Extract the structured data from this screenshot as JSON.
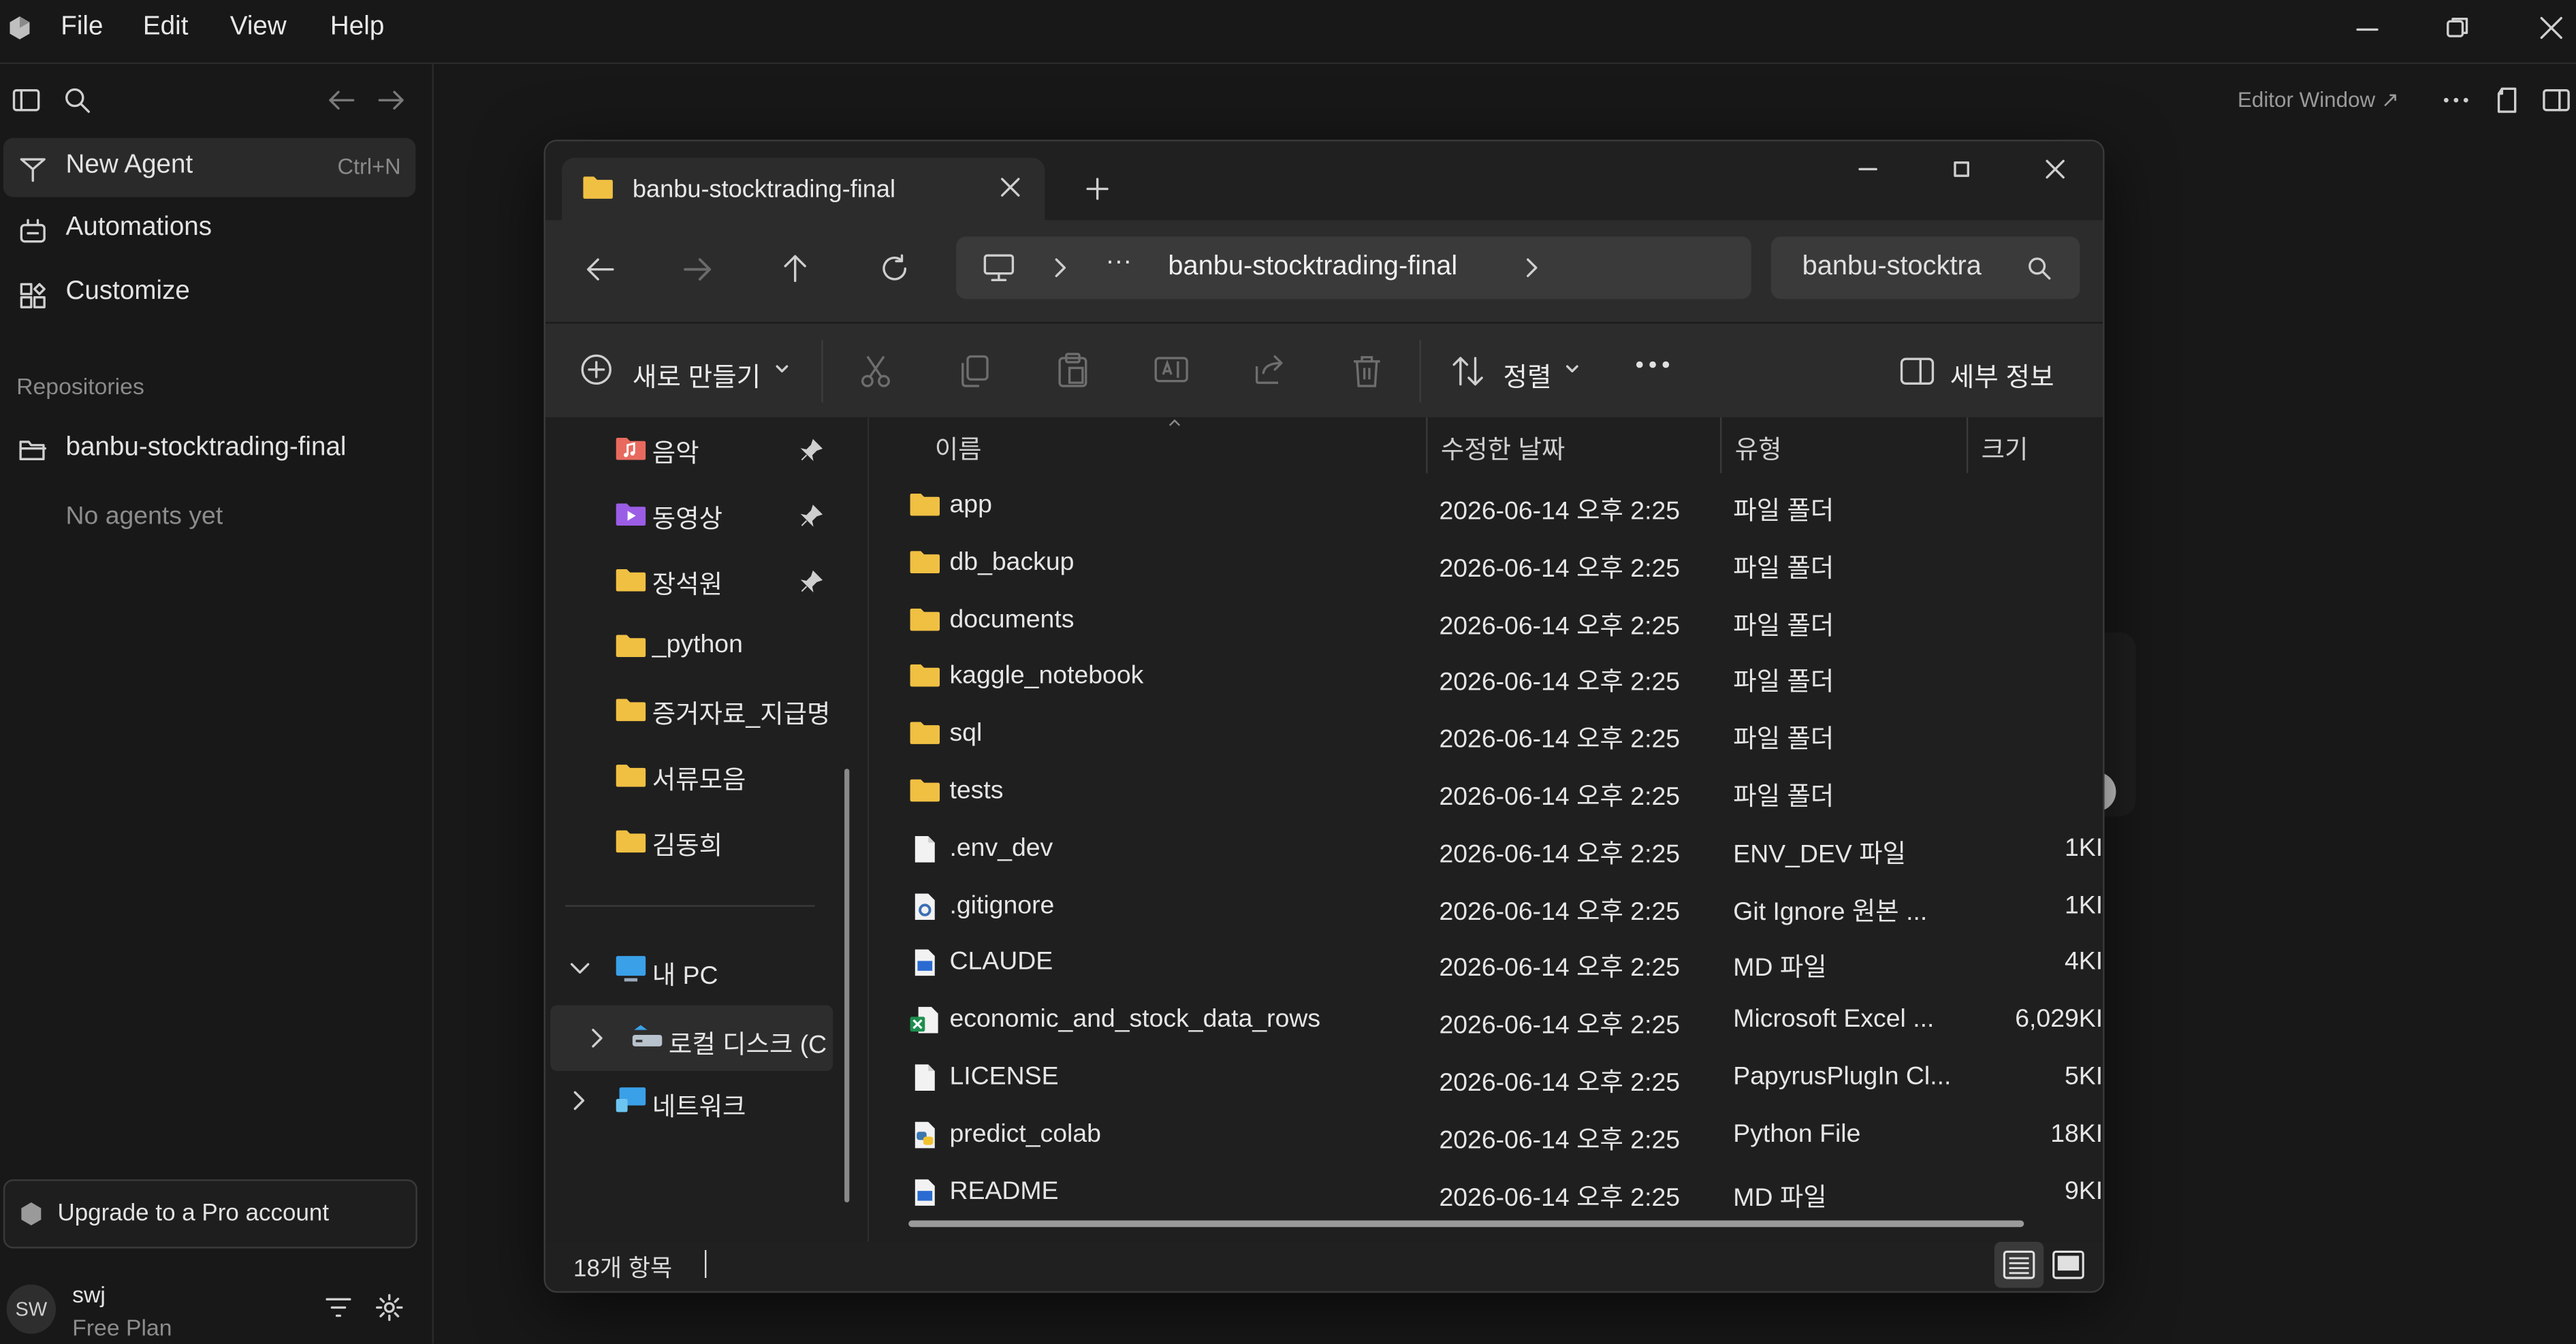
{
  "app": {
    "menu": [
      "File",
      "Edit",
      "View",
      "Help"
    ],
    "top_right": {
      "editor_window": "Editor Window ↗"
    }
  },
  "sidebar": {
    "new_agent": "New Agent",
    "new_agent_shortcut": "Ctrl+N",
    "automations": "Automations",
    "customize": "Customize",
    "repositories_header": "Repositories",
    "repo_name": "banbu-stocktrading-final",
    "no_agents": "No agents yet",
    "upgrade": "Upgrade to a Pro account",
    "user": {
      "initials": "SW",
      "name": "swj",
      "plan": "Free Plan"
    }
  },
  "explorer": {
    "tab_title": "banbu-stocktrading-final",
    "breadcrumb": {
      "ellipsis": "···",
      "current": "banbu-stocktrading-final"
    },
    "search_text": "banbu-stocktra",
    "cmd": {
      "new": "새로 만들기",
      "sort": "정렬",
      "details": "세부 정보"
    },
    "nav_items": [
      {
        "label": "음악",
        "icon": "music-folder-icon",
        "pinned": true
      },
      {
        "label": "동영상",
        "icon": "video-folder-icon",
        "pinned": true
      },
      {
        "label": "장석원",
        "icon": "folder-icon",
        "pinned": true
      },
      {
        "label": "_python",
        "icon": "folder-icon",
        "pinned": false
      },
      {
        "label": "증거자료_지급명",
        "icon": "folder-icon",
        "pinned": false
      },
      {
        "label": "서류모음",
        "icon": "folder-icon",
        "pinned": false
      },
      {
        "label": "김동희",
        "icon": "folder-icon",
        "pinned": false
      }
    ],
    "tree": {
      "this_pc": "내 PC",
      "local_disk": "로컬 디스크 (C",
      "network": "네트워크"
    },
    "columns": {
      "name": "이름",
      "modified": "수정한 날짜",
      "type": "유형",
      "size": "크기"
    },
    "files": [
      {
        "name": "app",
        "modified": "2026-06-14 오후 2:25",
        "type": "파일 폴더",
        "size": "",
        "icon": "folder-icon"
      },
      {
        "name": "db_backup",
        "modified": "2026-06-14 오후 2:25",
        "type": "파일 폴더",
        "size": "",
        "icon": "folder-icon"
      },
      {
        "name": "documents",
        "modified": "2026-06-14 오후 2:25",
        "type": "파일 폴더",
        "size": "",
        "icon": "folder-icon"
      },
      {
        "name": "kaggle_notebook",
        "modified": "2026-06-14 오후 2:25",
        "type": "파일 폴더",
        "size": "",
        "icon": "folder-icon"
      },
      {
        "name": "sql",
        "modified": "2026-06-14 오후 2:25",
        "type": "파일 폴더",
        "size": "",
        "icon": "folder-icon"
      },
      {
        "name": "tests",
        "modified": "2026-06-14 오후 2:25",
        "type": "파일 폴더",
        "size": "",
        "icon": "folder-icon"
      },
      {
        "name": ".env_dev",
        "modified": "2026-06-14 오후 2:25",
        "type": "ENV_DEV 파일",
        "size": "1KI",
        "icon": "file-icon"
      },
      {
        "name": ".gitignore",
        "modified": "2026-06-14 오후 2:25",
        "type": "Git Ignore 원본 ...",
        "size": "1KI",
        "icon": "gear-file-icon"
      },
      {
        "name": "CLAUDE",
        "modified": "2026-06-14 오후 2:25",
        "type": "MD 파일",
        "size": "4KI",
        "icon": "md-file-icon"
      },
      {
        "name": "economic_and_stock_data_rows",
        "modified": "2026-06-14 오후 2:25",
        "type": "Microsoft Excel ...",
        "size": "6,029KI",
        "icon": "excel-file-icon"
      },
      {
        "name": "LICENSE",
        "modified": "2026-06-14 오후 2:25",
        "type": "PapyrusPlugIn Cl...",
        "size": "5KI",
        "icon": "file-icon"
      },
      {
        "name": "predict_colab",
        "modified": "2026-06-14 오후 2:25",
        "type": "Python File",
        "size": "18KI",
        "icon": "python-file-icon"
      },
      {
        "name": "README",
        "modified": "2026-06-14 오후 2:25",
        "type": "MD 파일",
        "size": "9KI",
        "icon": "md-file-icon"
      }
    ],
    "status": "18개 항목"
  },
  "colors": {
    "folder": "#f0c043",
    "accent": "#4a9eff",
    "bg": "#181818"
  }
}
